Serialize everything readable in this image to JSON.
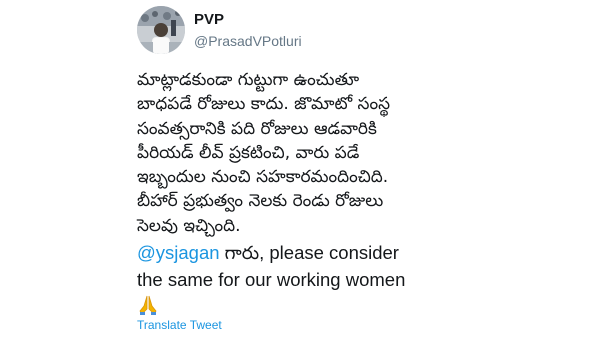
{
  "tweet": {
    "author": {
      "display_name": "PVP",
      "handle": "@PrasadVPotluri",
      "avatar_icon": "user-avatar-photo"
    },
    "body_lines": [
      "మాట్లాడకుండా గుట్టుగా ఉంచుతూ",
      "బాధపడే రోజులు కాదు. జొమాటో సంస్థ",
      "సంవత్సరానికి పది రోజులు ఆడవారికి",
      "పీరియడ్ లీవ్ ప్రకటించి, వారు పడే",
      "ఇబ్బందుల నుంచి సహకారమందించిది.",
      "బీహార్ ప్రభుత్వం నెలకు రెండు రోజులు",
      "సెలవు ఇచ్చింది."
    ],
    "mention": "@ysjagan",
    "mention_suffix": " గారు, please consider",
    "english_line_2": "the same for our working women",
    "emoji": "🙏",
    "emoji_icon": "folded-hands-icon",
    "translate_label": "Translate Tweet"
  },
  "colors": {
    "link": "#1b95e0",
    "text": "#14171a",
    "secondary": "#657786"
  }
}
